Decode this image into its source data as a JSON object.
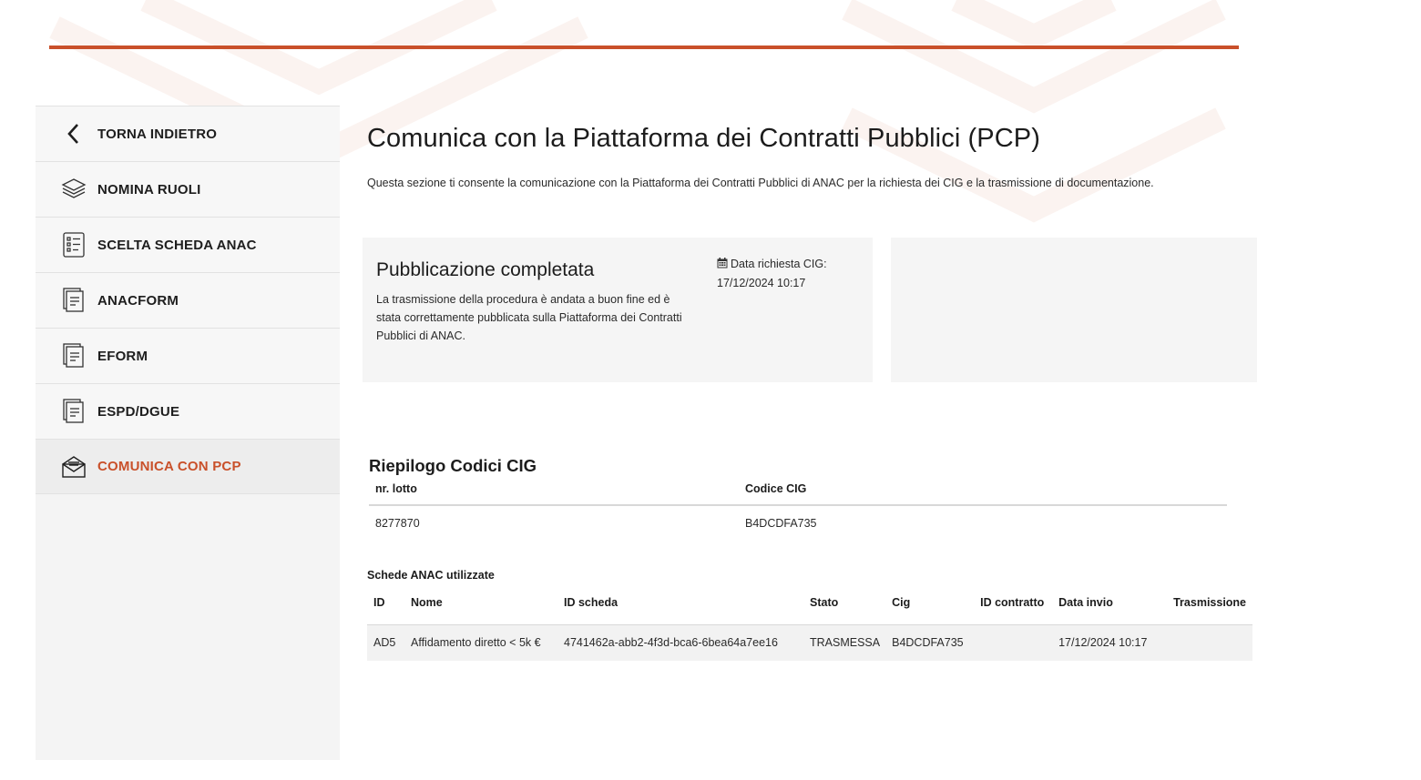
{
  "colors": {
    "accent": "#c9502a",
    "sidebar_bg": "#f4f4f4",
    "card_bg": "#f5f5f5"
  },
  "sidebar": {
    "items": [
      {
        "label": "TORNA INDIETRO",
        "icon": "chevron-left-icon"
      },
      {
        "label": "NOMINA RUOLI",
        "icon": "layers-icon"
      },
      {
        "label": "SCELTA SCHEDA ANAC",
        "icon": "checklist-icon"
      },
      {
        "label": "ANACFORM",
        "icon": "documents-icon"
      },
      {
        "label": "EFORM",
        "icon": "documents-icon"
      },
      {
        "label": "ESPD/DGUE",
        "icon": "documents-icon"
      },
      {
        "label": "COMUNICA CON PCP",
        "icon": "envelope-open-icon",
        "active": true
      }
    ]
  },
  "page": {
    "title": "Comunica con la Piattaforma dei Contratti Pubblici (PCP)",
    "description": "Questa sezione ti consente la comunicazione con la Piattaforma dei Contratti Pubblici di ANAC per la richiesta dei CIG e la trasmissione di documentazione."
  },
  "status_card": {
    "title": "Pubblicazione completata",
    "text": "La trasmissione della procedura è andata a buon fine ed è stata correttamente pubblicata sulla Piattaforma dei Contratti Pubblici di ANAC.",
    "date_label": "Data richiesta CIG:",
    "date_value": "17/12/2024 10:17"
  },
  "cig_summary": {
    "title": "Riepilogo Codici CIG",
    "headers": [
      "nr. lotto",
      "Codice CIG"
    ],
    "rows": [
      [
        "8277870",
        "B4DCDFA735"
      ]
    ]
  },
  "schede": {
    "title": "Schede ANAC utilizzate",
    "headers": [
      "ID",
      "Nome",
      "ID scheda",
      "Stato",
      "Cig",
      "ID contratto",
      "Data invio",
      "Trasmissione"
    ],
    "rows": [
      [
        "AD5",
        "Affidamento diretto < 5k €",
        "4741462a-abb2-4f3d-bca6-6bea64a7ee16",
        "TRASMESSA",
        "B4DCDFA735",
        "",
        "17/12/2024 10:17",
        ""
      ]
    ]
  }
}
